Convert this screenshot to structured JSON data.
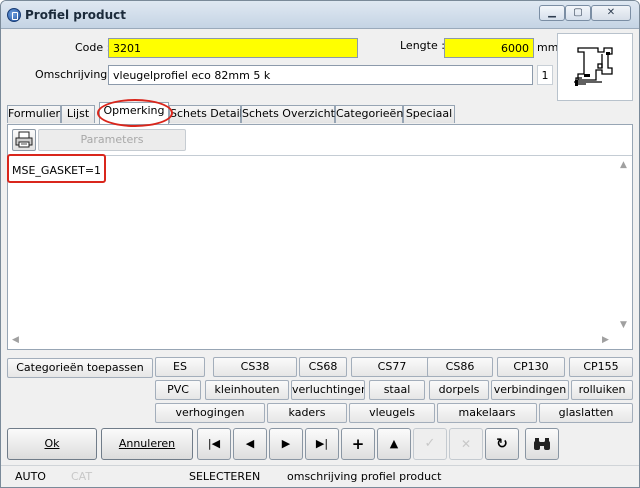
{
  "window": {
    "title": "Profiel product"
  },
  "form": {
    "code_label": "Code :",
    "code_value": "3201",
    "lengte_label": "Lengte :",
    "lengte_value": "6000",
    "lengte_unit": "mm",
    "omschrijving_label": "Omschrijving :",
    "omschrijving_value": "vleugelprofiel eco 82mm 5 k",
    "omschrijving_count": "1"
  },
  "tabs": [
    {
      "label": "Formulier"
    },
    {
      "label": "Lijst"
    },
    {
      "label": "Opmerking"
    },
    {
      "label": "Schets Detail"
    },
    {
      "label": "Schets Overzicht"
    },
    {
      "label": "Categorieën"
    },
    {
      "label": "Speciaal"
    }
  ],
  "panel": {
    "params_label": "Parameters",
    "memo_text": "MSE_GASKET=1"
  },
  "categories": {
    "apply_label": "Categorieën toepassen",
    "row1": [
      "ES",
      "CS38",
      "CS68",
      "CS77",
      "CS86",
      "CP130",
      "CP155"
    ],
    "row2": [
      "PVC",
      "kleinhouten",
      "verluchtingen",
      "staal",
      "dorpels",
      "verbindingen",
      "rolluiken"
    ],
    "row3": [
      "verhogingen",
      "kaders",
      "vleugels",
      "makelaars",
      "glaslatten"
    ]
  },
  "buttons": {
    "ok_label": "Ok",
    "annuleren_label": "Annuleren"
  },
  "status": {
    "mode": "AUTO",
    "cat": "CAT",
    "action": "SELECTEREN",
    "hint": "omschrijving profiel product"
  },
  "colors": {
    "highlight_yellow": "#ffff00",
    "annotation_red": "#d9261c"
  }
}
